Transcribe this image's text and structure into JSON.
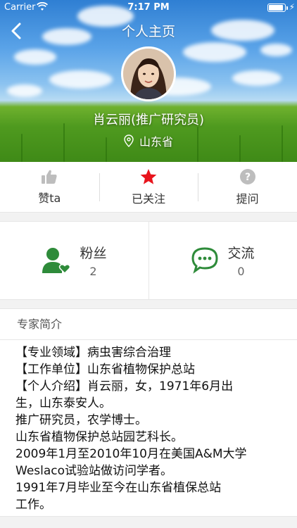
{
  "status_bar": {
    "carrier": "Carrier",
    "time": "7:17 PM",
    "battery_level": 0.9
  },
  "nav": {
    "title": "个人主页",
    "back_icon": "chevron-left-icon"
  },
  "profile": {
    "name": "肖云丽(推广研究员)",
    "location": "山东省"
  },
  "actions": [
    {
      "label": "赞ta",
      "icon": "thumbs-up-icon",
      "color": "#bdbdbd"
    },
    {
      "label": "已关注",
      "icon": "star-icon",
      "color": "#e8141c"
    },
    {
      "label": "提问",
      "icon": "question-icon",
      "color": "#bdbdbd"
    }
  ],
  "stats": [
    {
      "label": "粉丝",
      "count": "2",
      "icon": "user-heart-icon",
      "color": "#2e8b3a"
    },
    {
      "label": "交流",
      "count": "0",
      "icon": "chat-bubbles-icon",
      "color": "#2e8b3a"
    }
  ],
  "bio": {
    "header": "专家简介",
    "lines": [
      "【专业领域】病虫害综合治理",
      "【工作单位】山东省植物保护总站",
      "【个人介绍】肖云丽，女，1971年6月出",
      "生，山东泰安人。",
      "推广研究员，农学博士。",
      "山东省植物保护总站园艺科长。",
      "2009年1月至2010年10月在美国A&M大学",
      "Weslaco试验站做访问学者。",
      "1991年7月毕业至今在山东省植保总站",
      "工作。"
    ]
  }
}
